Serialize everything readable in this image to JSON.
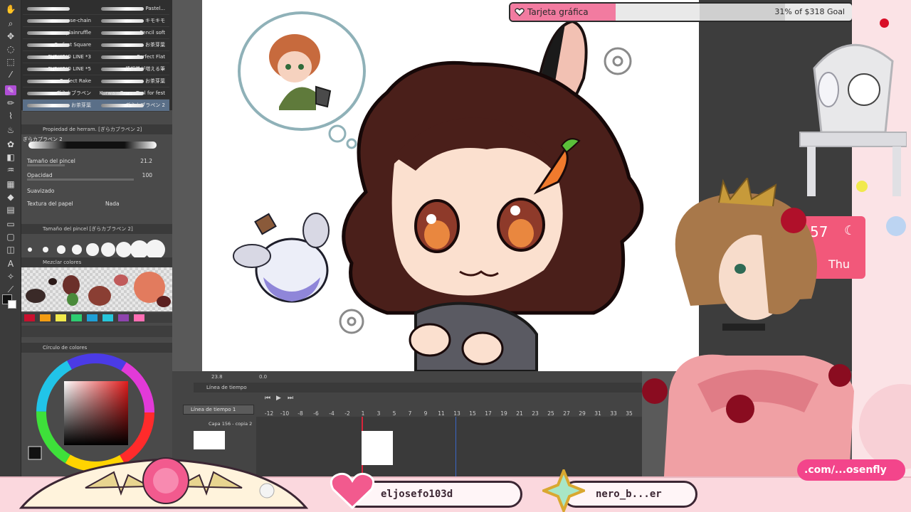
{
  "brushes": [
    {
      "left": "",
      "right": "Pastel..."
    },
    {
      "left": "rose-chain",
      "right": "キモキモ"
    },
    {
      "left": "plainruffle",
      "right": "Pencil soft"
    },
    {
      "left": "Perfect Square",
      "right": "お茶芽葉"
    },
    {
      "left": "PYOKIRIO LINE *3",
      "right": "Perfect Flat"
    },
    {
      "left": "PYOKIRIO LINE *5",
      "right": "情報量が増える筆"
    },
    {
      "left": "Perfect Rake",
      "right": "お茶芽葉"
    },
    {
      "left": "ぎらカブラペン",
      "right": "Kurwa - Curve Tool for fest"
    },
    {
      "left": "お茶芽葉",
      "right": "ぎらカブラペン 2"
    }
  ],
  "tool_property": {
    "title": "Propiedad de herram. [ぎらカブラペン 2]",
    "brush_name": "ぎらカブラペン 2",
    "rows": [
      {
        "label": "Tamaño del pincel",
        "value": "21.2",
        "fill": 0.35
      },
      {
        "label": "Opacidad",
        "value": "100",
        "fill": 1.0
      },
      {
        "label": "Suavizado",
        "value": ""
      },
      {
        "label": "Textura del papel",
        "value": "Nada"
      }
    ]
  },
  "brush_size": {
    "title": "Tamaño del pincel [ぎらカブラペン 2]",
    "sizes": [
      "7",
      "8",
      "10",
      "12",
      "15",
      "17",
      "20",
      "25",
      "30"
    ]
  },
  "mix_colors_title": "Mezclar colores",
  "color_wheel_title": "Círculo de colores",
  "swatches": [
    "#c8102e",
    "#f39c12",
    "#f1e94c",
    "#2ecc71",
    "#1f9fd6",
    "#26c6da",
    "#8e44ad",
    "#ff6eb4"
  ],
  "timeline": {
    "zoom": "23.8",
    "frame": "0.0",
    "panel_title": "Línea de tiempo",
    "select": "Línea de tiempo 1",
    "layer": "Capa 156 - copia 2",
    "frame_numbers": [
      "-12",
      "-10",
      "-8",
      "-6",
      "-4",
      "-2",
      "1",
      "3",
      "5",
      "7",
      "9",
      "11",
      "13",
      "15",
      "17",
      "19",
      "21",
      "23",
      "25",
      "27",
      "29",
      "31",
      "33",
      "35"
    ]
  },
  "goal": {
    "label": "Tarjeta gráfica",
    "status": "31% of $318 Goal",
    "progress": 0.31,
    "color": "#f27ba0"
  },
  "clock": {
    "time": "57",
    "day": "Thu",
    "icon": "moon-icon"
  },
  "socials": [
    {
      "handle": "eljosefo103d",
      "icon": "heart-icon"
    },
    {
      "handle": "nero_b...er",
      "icon": "star-icon"
    }
  ],
  "link_text": ".com/...osenfly",
  "colors": {
    "accent": "#f27ba0",
    "panel": "#4a4a4a",
    "canvas": "#ffffff",
    "record": "#d80f28"
  }
}
